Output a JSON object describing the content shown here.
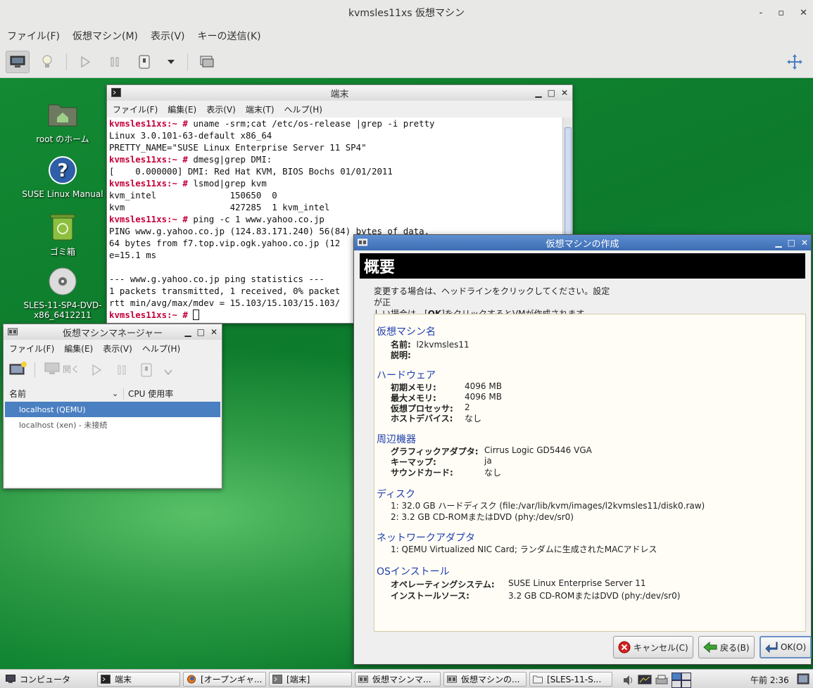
{
  "outer_window": {
    "title": "kvmsles11xs 仮想マシン",
    "controls": [
      "-",
      "▫",
      "✕"
    ],
    "menu": [
      "ファイル(F)",
      "仮想マシン(M)",
      "表示(V)",
      "キーの送信(K)"
    ]
  },
  "desktop_icons": [
    {
      "label": "root のホーム"
    },
    {
      "label": "SUSE Linux Manual"
    },
    {
      "label": "ゴミ箱"
    },
    {
      "label_line1": "SLES-11-SP4-DVD-",
      "label_line2": "x86_6412211"
    }
  ],
  "terminal": {
    "title": "端末",
    "menu": [
      "ファイル(F)",
      "編集(E)",
      "表示(V)",
      "端末(T)",
      "ヘルプ(H)"
    ],
    "lines": [
      {
        "prompt": "kvmsles11xs:~ #",
        "text": " uname -srm;cat /etc/os-release |grep -i pretty"
      },
      {
        "prompt": "",
        "text": "Linux 3.0.101-63-default x86_64"
      },
      {
        "prompt": "",
        "text": "PRETTY_NAME=\"SUSE Linux Enterprise Server 11 SP4\""
      },
      {
        "prompt": "kvmsles11xs:~ #",
        "text": " dmesg|grep DMI:"
      },
      {
        "prompt": "",
        "text": "[    0.000000] DMI: Red Hat KVM, BIOS Bochs 01/01/2011"
      },
      {
        "prompt": "kvmsles11xs:~ #",
        "text": " lsmod|grep kvm"
      },
      {
        "prompt": "",
        "text": "kvm_intel              150650  0"
      },
      {
        "prompt": "",
        "text": "kvm                    427285  1 kvm_intel"
      },
      {
        "prompt": "kvmsles11xs:~ #",
        "text": " ping -c 1 www.yahoo.co.jp"
      },
      {
        "prompt": "",
        "text": "PING www.g.yahoo.co.jp (124.83.171.240) 56(84) bytes of data."
      },
      {
        "prompt": "",
        "text": "64 bytes from f7.top.vip.ogk.yahoo.co.jp (12"
      },
      {
        "prompt": "",
        "text": "e=15.1 ms"
      },
      {
        "prompt": "",
        "text": ""
      },
      {
        "prompt": "",
        "text": "--- www.g.yahoo.co.jp ping statistics ---"
      },
      {
        "prompt": "",
        "text": "1 packets transmitted, 1 received, 0% packet"
      },
      {
        "prompt": "",
        "text": "rtt min/avg/max/mdev = 15.103/15.103/15.103/"
      },
      {
        "prompt": "kvmsles11xs:~ #",
        "text": " "
      }
    ]
  },
  "vmm": {
    "title": "仮想マシンマネージャー",
    "menu": [
      "ファイル(F)",
      "編集(E)",
      "表示(V)",
      "ヘルプ(H)"
    ],
    "open_label": "開く",
    "col_name": "名前",
    "col_cpu": "CPU 使用率",
    "rows": [
      "localhost (QEMU)",
      "localhost (xen) - 未接続"
    ]
  },
  "create_dialog": {
    "title": "仮想マシンの作成",
    "banner": "概要",
    "hint_line1": "変更する場合は、ヘッドラインをクリックしてください。設定が正",
    "hint_line2_pre": "しい場合は、[",
    "hint_line2_ok": "OK",
    "hint_line2_post": "]をクリックするとVMが作成されます。",
    "sections": {
      "vm_name": {
        "title": "仮想マシン名",
        "name_label": "名前:",
        "name_value": "l2kvmsles11",
        "desc_label": "説明:"
      },
      "hardware": {
        "title": "ハードウェア",
        "init_mem_label": "初期メモリ:",
        "init_mem_value": "4096 MB",
        "max_mem_label": "最大メモリ:",
        "max_mem_value": "4096 MB",
        "vcpu_label": "仮想プロセッサ:",
        "vcpu_value": "2",
        "host_dev_label": "ホストデバイス:",
        "host_dev_value": "なし"
      },
      "peripherals": {
        "title": "周辺機器",
        "graphics_label": "グラフィックアダプタ:",
        "graphics_value": "Cirrus Logic GD5446 VGA",
        "keymap_label": "キーマップ:",
        "keymap_value": "ja",
        "sound_label": "サウンドカード:",
        "sound_value": "なし"
      },
      "disks": {
        "title": "ディスク",
        "items": [
          "1: 32.0 GB ハードディスク (file:/var/lib/kvm/images/l2kvmsles11/disk0.raw)",
          "2: 3.2 GB CD-ROMまたはDVD (phy:/dev/sr0)"
        ]
      },
      "network": {
        "title": "ネットワークアダプタ",
        "items": [
          "1: QEMU Virtualized NIC Card; ランダムに生成されたMACアドレス"
        ]
      },
      "os_install": {
        "title": "OSインストール",
        "os_label": "オペレーティングシステム:",
        "os_value": "SUSE Linux Enterprise Server 11",
        "source_label": "インストールソース:",
        "source_value": "3.2 GB CD-ROMまたはDVD (phy:/dev/sr0)"
      }
    },
    "buttons": {
      "cancel": "キャンセル(C)",
      "back": "戻る(B)",
      "ok": "OK(O)"
    }
  },
  "taskbar": {
    "start": "コンピュータ",
    "tasks": [
      "端末",
      "[オープンギャ...",
      "[端末]",
      "仮想マシンマ...",
      "仮想マシンの...",
      "[SLES-11-S..."
    ],
    "clock": "午前 2:36"
  },
  "colors": {
    "prompt": "#c4003a",
    "section": "#1f3fae",
    "selection": "#4a7fc1",
    "desktop": "#0d7a2c"
  }
}
